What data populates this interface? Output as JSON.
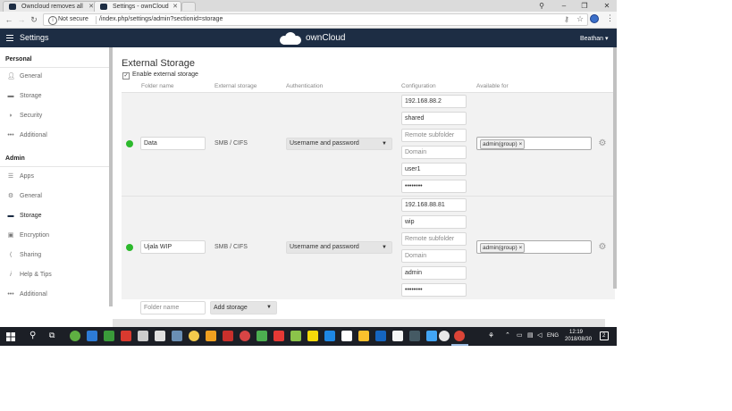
{
  "browser": {
    "tabs": [
      {
        "label": "Owncloud removes all"
      },
      {
        "label": "Settings - ownCloud"
      }
    ],
    "omnibox": {
      "security": "Not secure",
      "url_prefix": "",
      "url": "/index.php/settings/admin?sectionid=storage"
    }
  },
  "header": {
    "settings_label": "Settings",
    "brand": "ownCloud",
    "user": "Beathan"
  },
  "sidebar": {
    "personal_heading": "Personal",
    "personal_items": [
      {
        "label": "General",
        "icon": "user-icon"
      },
      {
        "label": "Storage",
        "icon": "folder-icon"
      },
      {
        "label": "Security",
        "icon": "shield-icon"
      },
      {
        "label": "Additional",
        "icon": "dots-icon"
      }
    ],
    "admin_heading": "Admin",
    "admin_items": [
      {
        "label": "Apps",
        "icon": "list-icon"
      },
      {
        "label": "General",
        "icon": "gear-icon"
      },
      {
        "label": "Storage",
        "icon": "folder-icon"
      },
      {
        "label": "Encryption",
        "icon": "lock-icon"
      },
      {
        "label": "Sharing",
        "icon": "share-icon"
      },
      {
        "label": "Help & Tips",
        "icon": "info-icon"
      },
      {
        "label": "Additional",
        "icon": "dots-icon"
      }
    ]
  },
  "main": {
    "title": "External Storage",
    "enable_label": "Enable external storage",
    "columns": {
      "folder": "Folder name",
      "external": "External storage",
      "auth": "Authentication",
      "config": "Configuration",
      "available": "Available for"
    },
    "mounts": [
      {
        "folder": "Data",
        "storage": "SMB / CIFS",
        "auth": "Username and password",
        "config": [
          "192.168.88.2",
          "shared",
          "Remote subfolder",
          "Domain",
          "user1",
          "••••••••"
        ],
        "available_tag": "admin(group)"
      },
      {
        "folder": "Ujala WIP",
        "storage": "SMB / CIFS",
        "auth": "Username and password",
        "config": [
          "192.168.88.81",
          "wip",
          "Remote subfolder",
          "Domain",
          "admin",
          "••••••••"
        ],
        "available_tag": "admin(group)"
      }
    ],
    "new_folder_placeholder": "Folder name",
    "add_storage_label": "Add storage"
  },
  "taskbar": {
    "lang": "ENG",
    "time": "12:19",
    "date": "2018/08/30",
    "notifications": "2"
  },
  "colors": {
    "header_bg": "#1d2d44",
    "status_ok": "#2cb92c",
    "taskbar_bg": "#1c1f26"
  }
}
